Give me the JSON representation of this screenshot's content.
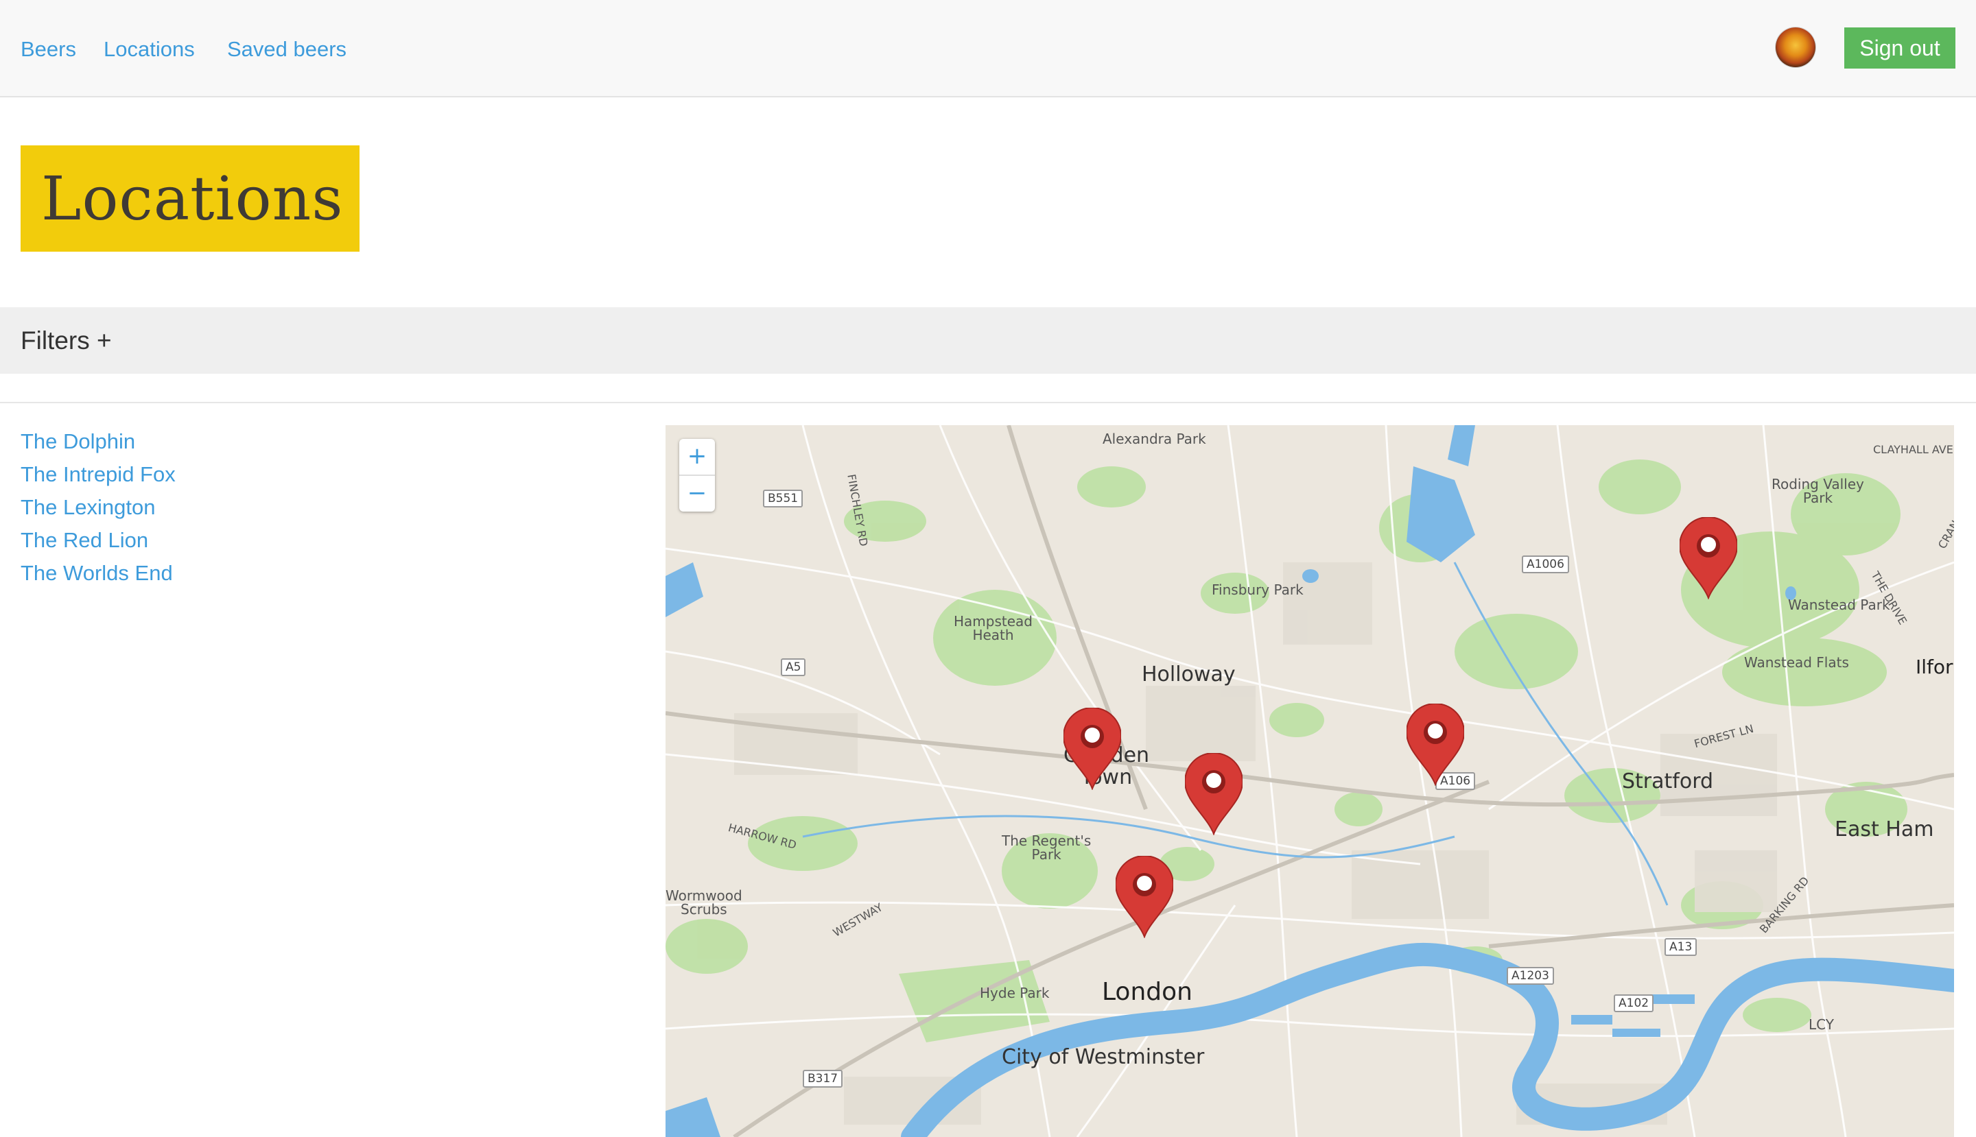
{
  "nav": {
    "links": [
      "Beers",
      "Locations",
      "Saved beers"
    ],
    "signout_label": "Sign out"
  },
  "page": {
    "title": "Locations"
  },
  "filters": {
    "label": "Filters +"
  },
  "locations": [
    "The Dolphin",
    "The Intrepid Fox",
    "The Lexington",
    "The Red Lion",
    "The Worlds End"
  ],
  "map": {
    "zoom_in": "+",
    "zoom_out": "−",
    "places": {
      "alexandra_park": "Alexandra Park",
      "clayhall": "CLAYHALL AVE",
      "roding_valley": "Roding Valley\nPark",
      "finchley_rd": "FINCHLEY RD",
      "finsbury_park": "Finsbury Park",
      "hampstead_heath": "Hampstead\nHeath",
      "wanstead_park": "Wanstead Park",
      "the_drive": "THE DRIVE",
      "wanstead_flats": "Wanstead Flats",
      "ilford": "Ilfor",
      "holloway": "Holloway",
      "forest_ln": "FOREST LN",
      "camden_town": "Camden\nTown",
      "stratford": "Stratford",
      "east_ham": "East Ham",
      "harrow_rd": "HARROW RD",
      "regents_park": "The Regent's\nPark",
      "barking_rd": "BARKING RD",
      "westway": "WESTWAY",
      "wormwood_scrubs": "Wormwood\nScrubs",
      "hyde_park": "Hyde Park",
      "london": "London",
      "lcy": "LCY",
      "city_of_westminster": "City of Westminster",
      "crane": "CRAN"
    },
    "roads": {
      "b551": "B551",
      "a1006": "A1006",
      "a5": "A5",
      "a106": "A106",
      "a13": "A13",
      "a1203": "A1203",
      "a102": "A102",
      "b317": "B317"
    },
    "marker_count": 5,
    "marker_color": "#d63a35"
  }
}
